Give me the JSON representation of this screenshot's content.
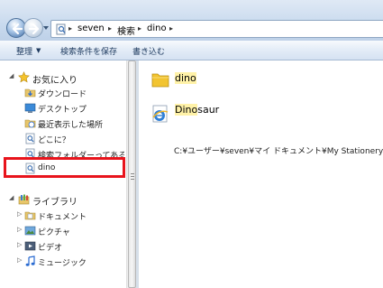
{
  "address_bar": {
    "crumbs": [
      "seven",
      "検索",
      "dino"
    ],
    "separator": "▸"
  },
  "toolbar": {
    "organize_label": "整理",
    "save_search_label": "検索条件を保存",
    "burn_label": "書き込む"
  },
  "nav_pane": {
    "favorites": {
      "label": "お気に入り",
      "items": [
        {
          "label": "ダウンロード",
          "icon": "download-folder-icon"
        },
        {
          "label": "デスクトップ",
          "icon": "desktop-icon"
        },
        {
          "label": "最近表示した場所",
          "icon": "recent-places-icon"
        },
        {
          "label": "どこに？",
          "icon": "saved-search-icon"
        },
        {
          "label": "検索フォルダーってあるの",
          "icon": "saved-search-icon"
        },
        {
          "label": "dino",
          "icon": "saved-search-icon"
        }
      ]
    },
    "libraries": {
      "label": "ライブラリ",
      "items": [
        {
          "label": "ドキュメント",
          "icon": "documents-icon"
        },
        {
          "label": "ピクチャ",
          "icon": "pictures-icon"
        },
        {
          "label": "ビデオ",
          "icon": "videos-icon"
        },
        {
          "label": "ミュージック",
          "icon": "music-icon"
        }
      ]
    }
  },
  "content": {
    "results": [
      {
        "name_hl": "dino",
        "name_rest": "",
        "icon": "folder-icon"
      },
      {
        "name_hl": "Dino",
        "name_rest": "saur",
        "icon": "internet-explorer-icon"
      }
    ],
    "path": "C:¥ユーザー¥seven¥マイ ドキュメント¥My Stationery"
  },
  "colors": {
    "highlight_box": "#e8141c",
    "match_highlight": "#fff2a8",
    "toolbar_text": "#1e3a5f"
  }
}
